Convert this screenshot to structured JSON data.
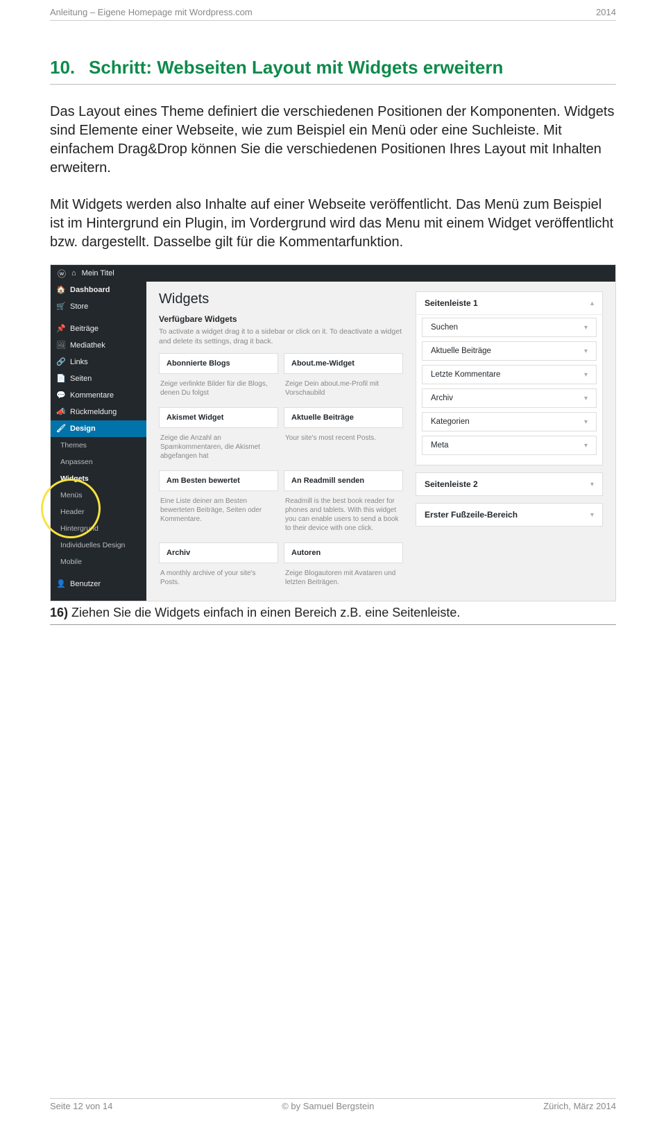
{
  "doc_header": {
    "left": "Anleitung – Eigene Homepage mit Wordpress.com",
    "right": "2014"
  },
  "section": {
    "number": "10.",
    "title": "Schritt: Webseiten Layout mit Widgets erweitern"
  },
  "para1": "Das Layout eines Theme definiert die verschiedenen Positionen der Komponenten. Widgets sind Elemente einer Webseite, wie zum Beispiel ein Menü oder eine Suchleiste. Mit einfachem Drag&Drop können Sie die verschiedenen Positionen Ihres Layout mit Inhalten erweitern.",
  "para2": "Mit Widgets werden also Inhalte auf einer Webseite veröffentlicht. Das Menü zum Beispiel ist im Hintergrund ein Plugin, im Vordergrund wird das Menu mit einem Widget veröffentlicht bzw. dargestellt. Dasselbe gilt für die Kommentarfunktion.",
  "wp": {
    "site_title": "Mein Titel",
    "sidebar": {
      "items": [
        {
          "icon": "🏠",
          "label": "Dashboard"
        },
        {
          "icon": "🛒",
          "label": "Store"
        },
        {
          "icon": "📌",
          "label": "Beiträge"
        },
        {
          "icon": "🖼",
          "label": "Mediathek"
        },
        {
          "icon": "🔗",
          "label": "Links"
        },
        {
          "icon": "📄",
          "label": "Seiten"
        },
        {
          "icon": "💬",
          "label": "Kommentare"
        },
        {
          "icon": "📣",
          "label": "Rückmeldung"
        },
        {
          "icon": "🖌",
          "label": "Design",
          "active": true
        }
      ],
      "sub": [
        "Themes",
        "Anpassen",
        "Widgets",
        "Menüs",
        "Header",
        "Hintergrund",
        "Individuelles Design",
        "Mobile"
      ],
      "bottom": {
        "icon": "👤",
        "label": "Benutzer"
      }
    },
    "main": {
      "h1": "Widgets",
      "sub": "Verfügbare Widgets",
      "help": "To activate a widget drag it to a sidebar or click on it. To deactivate a widget and delete its settings, drag it back.",
      "widgets": [
        {
          "title": "Abonnierte Blogs",
          "desc": "Zeige verlinkte Bilder für die Blogs, denen Du folgst"
        },
        {
          "title": "About.me-Widget",
          "desc": "Zeige Dein about.me-Profil mit Vorschaubild"
        },
        {
          "title": "Akismet Widget",
          "desc": "Zeige die Anzahl an Spamkommentaren, die Akismet abgefangen hat"
        },
        {
          "title": "Aktuelle Beiträge",
          "desc": "Your site's most recent Posts."
        },
        {
          "title": "Am Besten bewertet",
          "desc": "Eine Liste deiner am Besten bewerteten Beiträge, Seiten oder Kommentare."
        },
        {
          "title": "An Readmill senden",
          "desc": "Readmill is the best book reader for phones and tablets. With this widget you can enable users to send a book to their device with one click."
        },
        {
          "title": "Archiv",
          "desc": "A monthly archive of your site's Posts."
        },
        {
          "title": "Autoren",
          "desc": "Zeige Blogautoren mit Avataren und letzten Beiträgen."
        }
      ]
    },
    "right": {
      "areas": [
        {
          "title": "Seitenleiste 1",
          "expanded": true,
          "chev": "▴",
          "items": [
            "Suchen",
            "Aktuelle Beiträge",
            "Letzte Kommentare",
            "Archiv",
            "Kategorien",
            "Meta"
          ]
        },
        {
          "title": "Seitenleiste 2",
          "chev": "▾"
        },
        {
          "title": "Erster Fußzeile-Bereich",
          "chev": "▾"
        }
      ]
    }
  },
  "caption": {
    "num": "16)",
    "text": " Ziehen Sie die Widgets einfach in einen Bereich z.B. eine Seitenleiste."
  },
  "doc_footer": {
    "left": "Seite 12 von 14",
    "center": "© by Samuel Bergstein",
    "right": "Zürich, März 2014"
  }
}
